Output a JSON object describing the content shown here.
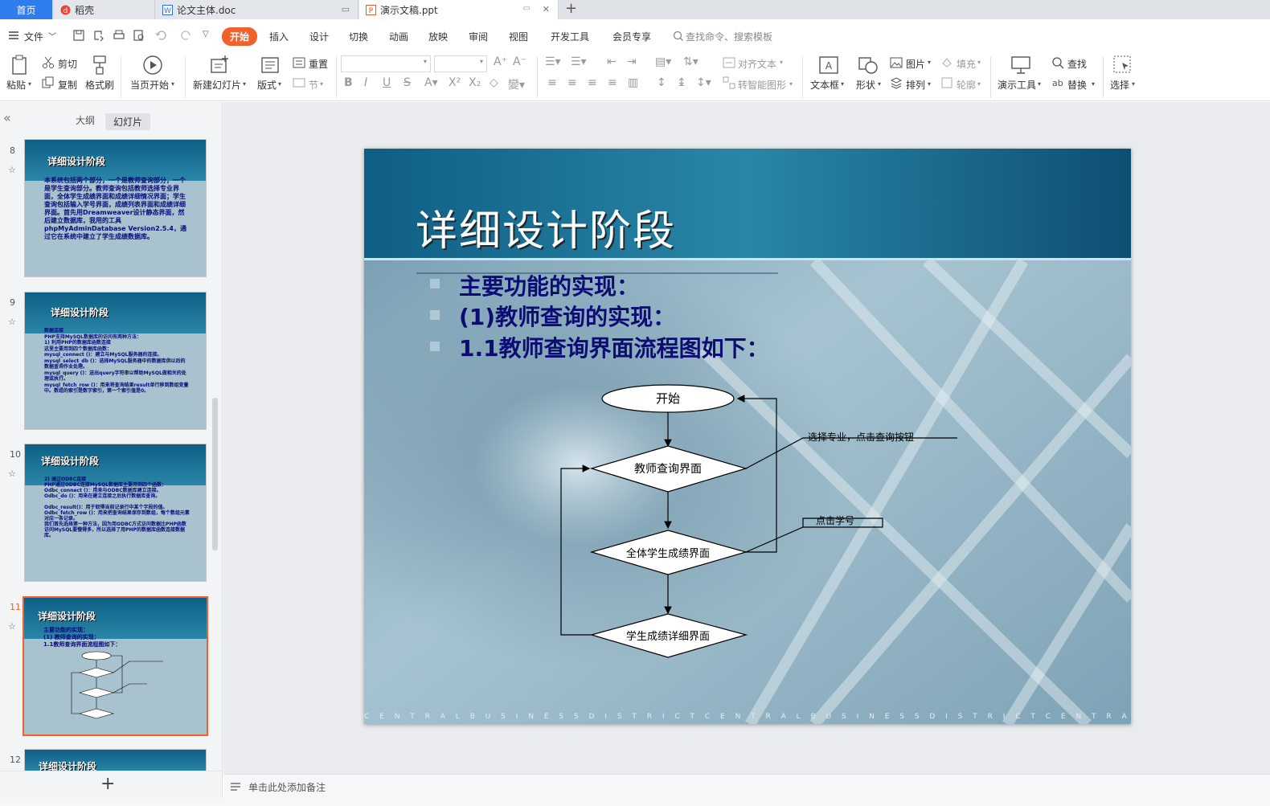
{
  "tabs": {
    "home": "首页",
    "t1": "稻壳",
    "t2": "论文主体.doc",
    "t3": "演示文稿.ppt"
  },
  "menu": {
    "file": "文件",
    "items": [
      "开始",
      "插入",
      "设计",
      "切换",
      "动画",
      "放映",
      "审阅",
      "视图",
      "开发工具",
      "会员专享"
    ],
    "search": "查找命令、搜索模板"
  },
  "ribbon": {
    "paste": "粘贴",
    "cut": "剪切",
    "copy": "复制",
    "format_painter": "格式刷",
    "from_start": "当页开始",
    "new_slide": "新建幻灯片",
    "layout": "版式",
    "reset": "重置",
    "section": "节",
    "align_text": "对齐文本",
    "smartart": "转智能图形",
    "textbox": "文本框",
    "shape": "形状",
    "picture": "图片",
    "arrange": "排列",
    "fill": "填充",
    "outline": "轮廓",
    "present_tool": "演示工具",
    "find": "查找",
    "replace": "替换",
    "select": "选择"
  },
  "panel": {
    "outline": "大纲",
    "slides": "幻灯片",
    "add": "+"
  },
  "thumbs": [
    {
      "num": "8",
      "title": "详细设计阶段",
      "body": "本系统包括两个部分，一个是教师查询部分，一个是学生查询部分。教师查询包括教师选择专业界面，全体学生成绩界面和成绩详细情况界面；学生查询包括输入学号界面，成绩列表界面和成绩详细界面。首先用Dreamweaver设计静态界面，然后建立数据库，我用的工具phpMyAdminDatabase Version2.5.4，通过它在系统中建立了学生成绩数据库。"
    },
    {
      "num": "9",
      "title": "详细设计阶段",
      "body": "数据连接\nPHP支持MySQL数据库的访问有两种方法：\n1) 利用PHP的数据库函数连接\n这里主要用到四个数据库函数：\nmysql_connect ()：建立与MySQL服务器的连接。\nmysql_select_db ()：选择MySQL服务器中的数据库供以后的数据查询作业处理。\nmysql_query ()：送出query字符串以帮助MySQL做相关的处理或执行。\nmysql_fetch_row ()：用来将查询结果result单行移到数组变量中。数组的索引是数字索引，第一个索引值是0。"
    },
    {
      "num": "10",
      "title": "详细设计阶段",
      "body": "2) 通过ODBC连接\nPHP通过ODBC连接MySQL数据库主要用到四个函数：\nOdbc_connect ()：用来与ODBC数据库建立连接。\nOdbc_do ()：用来在建立连接之后执行数据库查询。\n\nOdbc_result()：用于取得当前记录行中某个字段的值。\nOdbc_fetch_row ()：用来把查询结果保存到数组，每个数组元素对应一条记录。\n我们首先选择第一种方法，因为用ODBC方式访问数据比PHP函数访问MySQL要慢得多，所以选择了用PHP的数据库函数连接数据库。"
    },
    {
      "num": "11",
      "title": "详细设计阶段",
      "body": "主要功能的实现：\n(1) 教师查询的实现：\n1.1教师查询界面流程图如下："
    },
    {
      "num": "12",
      "title": "详细设计阶段",
      "body": ""
    }
  ],
  "slide": {
    "title": "详细设计阶段",
    "bullets": [
      "主要功能的实现：",
      "(1)教师查询的实现：",
      "1.1教师查询界面流程图如下："
    ],
    "flow": {
      "start": "开始",
      "n1": "教师查询界面",
      "n2": "全体学生成绩界面",
      "n3": "学生成绩详细界面",
      "note1": "选择专业，点击查询按钮",
      "note2": "点击学号"
    },
    "watermark": "C E N T R A L B U S I N E S S D I S T R I C T C E N T R A L B U S I N E S S D I S T R I C T C E N T R A"
  },
  "notes": "单击此处添加备注",
  "colors": {
    "accent": "#f0612d",
    "home_tab": "#2f7ded",
    "title_bar": "#0e5f86",
    "bullet_text": "#0c0c74"
  }
}
